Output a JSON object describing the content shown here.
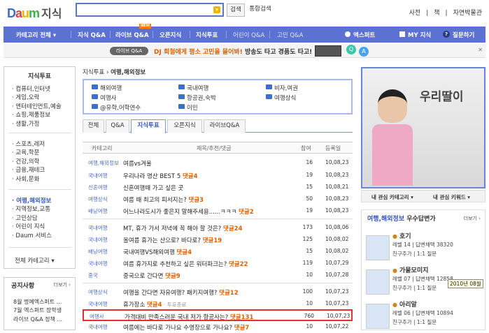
{
  "header": {
    "logo_brand": "Daum",
    "logo_section": "지식",
    "search_button": "검색",
    "integrated_search": "통합검색",
    "top_links": [
      "사전",
      "책",
      "자연박물관"
    ]
  },
  "nav": {
    "items": [
      "카테고리 전체 ▾",
      "지식 Q&A",
      "라이브 Q&A",
      "오픈지식",
      "지식투표",
      "어린이 Q&A",
      "고민 Q&A",
      "엑스퍼트",
      "MY 지식",
      "질문하기"
    ],
    "new_badge": "NEW"
  },
  "banner": {
    "pill": "라이브 Q&A",
    "text_highlight": "DJ 회철에게 평소 고민을 물어봐!",
    "text_rest": " 방송도 타고 경품도 타고!"
  },
  "left_sidebar": {
    "title": "지식투표",
    "group1": [
      "컴퓨터,인터넷",
      "게임,오락",
      "엔터테인먼트,예술",
      "쇼핑,제품정보",
      "생활,가정"
    ],
    "group2": [
      "스포츠,레저",
      "교육,학문",
      "건강,의학",
      "금융,재테크",
      "사회,문화"
    ],
    "group3": [
      "여행,해외정보",
      "지역정보,교통",
      "고민상담",
      "어린이 지식",
      "Daum 서비스"
    ],
    "all_categories": "전체 카테고리 ▾"
  },
  "notice": {
    "title": "공지사항",
    "more": "더보기 ›",
    "items": [
      "8월 명예엑스퍼트 ...",
      "7월 엑스퍼트 장학생",
      "라이브 Q&A 정책 ..."
    ]
  },
  "main": {
    "breadcrumb_root": "지식투표 ›",
    "breadcrumb_current": "여행,해외정보",
    "categories": [
      "해외여행",
      "국내여행",
      "비자,여권",
      "여행사",
      "항공권,숙박",
      "여행상식",
      "@유학,어학연수",
      "이민"
    ],
    "tabs": [
      "전체",
      "Q&A",
      "지식투표",
      "오픈지식",
      "라이브Q&A"
    ],
    "columns": [
      "카테고리",
      "제목/추천/댓글",
      "참여",
      "등록일"
    ],
    "rows": [
      {
        "cat": "여행,해외정보",
        "title": "여름vs겨울",
        "comment": "",
        "tag": "",
        "views": "16",
        "date": "10,08,23"
      },
      {
        "cat": "국내여행",
        "title": "우리나라 명산 BEST 5",
        "comment": "댓글4",
        "tag": "",
        "views": "19",
        "date": "10,08,23"
      },
      {
        "cat": "신혼여행",
        "title": "신혼여행때 가고 싶은 곳",
        "comment": "",
        "tag": "",
        "views": "15",
        "date": "10,08,21"
      },
      {
        "cat": "여행상식",
        "title": "여름 때 최고의 피서지는?",
        "comment": "댓글3",
        "tag": "",
        "views": "50",
        "date": "10,08,23"
      },
      {
        "cat": "배낭여행",
        "title": "어느나라도시가 좋은지 말해주세용......ㅋㅋㅋ",
        "comment": "댓글2",
        "tag": "",
        "views": "19",
        "date": "10,08,23"
      },
      {
        "cat": "국내여행",
        "title": "MT, 휴가 가서 저녁에 꼭 해야 할 것은?",
        "comment": "댓글24",
        "tag": "",
        "views": "173",
        "date": "10,08,06"
      },
      {
        "cat": "국내여행",
        "title": "올여름 휴가는 산으로? 바다로?",
        "comment": "댓글19",
        "tag": "",
        "views": "125",
        "date": "10,08,02"
      },
      {
        "cat": "배낭여행",
        "title": "국내여행VS해외여행",
        "comment": "댓글4",
        "tag": "",
        "views": "15",
        "date": "10,08,02"
      },
      {
        "cat": "국내여행",
        "title": "여름 휴가지로 추천하고 싶은 워터파크는?",
        "comment": "댓글22",
        "tag": "",
        "views": "119",
        "date": "10,07,29"
      },
      {
        "cat": "중국",
        "title": "중국으로 간다면",
        "comment": "댓글9",
        "tag": "",
        "views": "10",
        "date": "10,07,28"
      },
      {
        "cat": "여행상식",
        "title": "여행을 간다면 자유여행? 패키지여행?",
        "comment": "댓글12",
        "tag": "",
        "views": "100",
        "date": "10,07,23"
      },
      {
        "cat": "국내여행",
        "title": "휴가장소",
        "comment": "댓글4",
        "tag": " · 투표종료",
        "views": "10",
        "date": "10,07,23"
      },
      {
        "cat": "여행사",
        "title": "가격대비 만족스러운 국내 저가 항공사는?",
        "comment": "댓글131",
        "tag": "",
        "views": "760",
        "date": "10,07,23"
      },
      {
        "cat": "국내여행",
        "title": "여름에는 바다로 가나요 수영장으로 가나요?",
        "comment": "댓글7",
        "tag": "",
        "views": "10",
        "date": "10,07,22"
      }
    ]
  },
  "right": {
    "ad_caption": "우리딸이",
    "my_category": "내 관심 카테고리 ▾",
    "my_keyword": "내 관심 키워드 ▾",
    "expert_title_cat": "여행,해외정보",
    "expert_title_rest": " 우수답변가",
    "expert_more": "더보기 ›",
    "experts": [
      {
        "rank": "1",
        "name": "호기",
        "l1": "레벨 14 | 답변채택 38320",
        "l2": "친구추가 | 1:1 질문"
      },
      {
        "rank": "2",
        "name": "가물모미지",
        "l1": "레벨 07 | 답변채택 12858",
        "l2": "친구추가 | 1:1 질문"
      },
      {
        "rank": "3",
        "name": "아리알",
        "l1": "레벨 06 | 답변채택 10894",
        "l2": "친구추가 | 1:1 질문"
      }
    ],
    "stamp": "2010년 08월"
  },
  "colors": {
    "nav": "#5b72d3",
    "accent": "#e06000",
    "link": "#3355bb",
    "highlight": "#e53030"
  }
}
